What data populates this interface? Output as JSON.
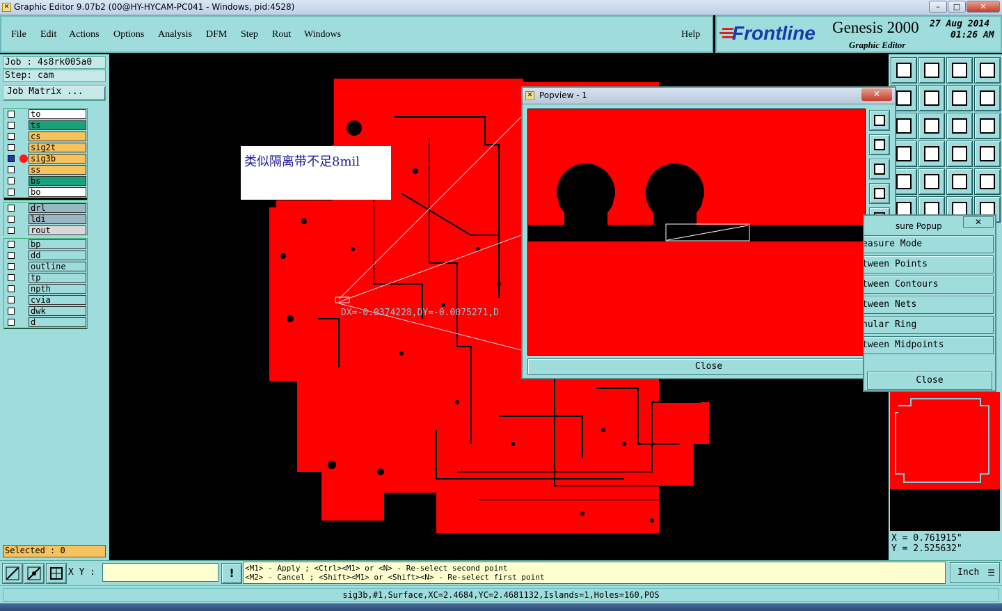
{
  "window": {
    "title": "Graphic Editor 9.07b2 (00@HY-HYCAM-PC041 - Windows, pid:4528)",
    "min_icon": "minimize-icon",
    "max_icon": "maximize-icon",
    "close_icon": "close-icon"
  },
  "menu": {
    "file": "File",
    "edit": "Edit",
    "actions": "Actions",
    "options": "Options",
    "analysis": "Analysis",
    "dfm": "DFM",
    "step": "Step",
    "rout": "Rout",
    "windows": "Windows",
    "help": "Help"
  },
  "brand": {
    "logo": "Frontline",
    "product": "Genesis 2000",
    "subtitle": "Graphic Editor",
    "date": "27 Aug 2014",
    "time": "01:26 AM"
  },
  "job": {
    "job": "Job : 4s8rk005a0",
    "step": "Step: cam",
    "matrix_button": "Job Matrix ..."
  },
  "layers": {
    "board": [
      {
        "name": "to",
        "color": "#ffffff"
      },
      {
        "name": "ts",
        "color": "#1aa07a"
      },
      {
        "name": "cs",
        "color": "#f6c25c"
      },
      {
        "name": "sig2t",
        "color": "#f6c25c"
      },
      {
        "name": "sig3b",
        "color": "#f6c25c"
      },
      {
        "name": "ss",
        "color": "#f6c25c"
      },
      {
        "name": "bs",
        "color": "#1aa07a"
      },
      {
        "name": "bo",
        "color": "#ffffff"
      }
    ],
    "drill": [
      {
        "name": "drl",
        "color": "#9ab7c4"
      },
      {
        "name": "ldi",
        "color": "#9ab7c4"
      },
      {
        "name": "rout",
        "color": "#d8d8d8"
      }
    ],
    "misc": [
      {
        "name": "bp",
        "color": "#9fdcdc"
      },
      {
        "name": "dd",
        "color": "#9fdcdc"
      },
      {
        "name": "outline",
        "color": "#9fdcdc"
      },
      {
        "name": "tp",
        "color": "#9fdcdc"
      },
      {
        "name": "npth",
        "color": "#9fdcdc"
      },
      {
        "name": "cvia",
        "color": "#9fdcdc"
      },
      {
        "name": "dwk",
        "color": "#9fdcdc"
      },
      {
        "name": "d",
        "color": "#9fdcdc"
      }
    ]
  },
  "selected": "Selected : 0",
  "annotation": "类似隔离带不足8mil",
  "measure_readout": "DX=-0.0374228,DY=-0.0075271,D",
  "popview": {
    "title": "Popview - 1",
    "close": "Close"
  },
  "measure_popup": {
    "title": "sure Popup",
    "items": [
      "easure Mode",
      "tween Points",
      "tween Contours",
      "tween Nets",
      "nular Ring",
      "tween Midpoints"
    ],
    "close": "Close"
  },
  "coords": {
    "x": "X = 0.761915\"",
    "y": "Y = 2.525632\""
  },
  "command": {
    "xy_label": "X Y :",
    "xy_value": "",
    "hint1": "<M1> - Apply  ; <Ctrl><M1> or <N> - Re-select second point",
    "hint2": "<M2> - Cancel ; <Shift><M1> or <Shift><N> - Re-select first point",
    "units": "Inch"
  },
  "status": "sig3b,#1,Surface,XC=2.4684,YC=2.4681132,Islands=1,Holes=160,POS",
  "colors": {
    "panel": "#9fdcdc",
    "board": "#ff0000",
    "background": "#000000"
  }
}
